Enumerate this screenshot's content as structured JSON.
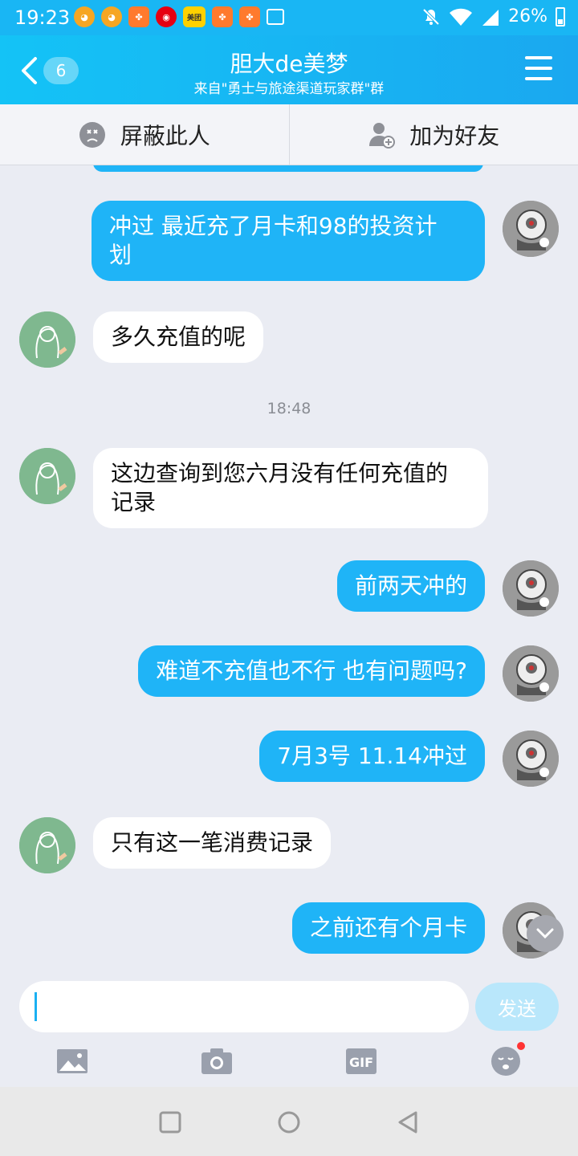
{
  "status_bar": {
    "time": "19:23",
    "battery": "26%",
    "notif_mt": "美团"
  },
  "header": {
    "back_count": "6",
    "title": "胆大de美梦",
    "subtitle": "来自\"勇士与旅途渠道玩家群\"群"
  },
  "actions": {
    "block_label": "屏蔽此人",
    "add_friend_label": "加为好友"
  },
  "messages": [
    {
      "sender": "me",
      "text": "冲过 最近充了月卡和98的投资计\n划"
    },
    {
      "sender": "them",
      "text": "多久充值的呢"
    },
    {
      "type": "time",
      "text": "18:48"
    },
    {
      "sender": "them",
      "text": "这边查询到您六月没有任何充值的\n记录"
    },
    {
      "sender": "me",
      "text": "前两天冲的"
    },
    {
      "sender": "me",
      "text": "难道不充值也不行 也有问题吗?"
    },
    {
      "sender": "me",
      "text": "7月3号 11.14冲过"
    },
    {
      "sender": "them",
      "text": "只有这一笔消费记录"
    },
    {
      "sender": "me",
      "text": "之前还有个月卡"
    }
  ],
  "input": {
    "placeholder": "",
    "send_label": "发送"
  },
  "toolbar": {
    "icons": [
      "image-icon",
      "camera-icon",
      "gif-icon",
      "emoji-icon"
    ],
    "gif_label": "GIF"
  },
  "colors": {
    "accent": "#1fb4f7",
    "header": "#19b6f4",
    "background": "#eaecf3"
  }
}
